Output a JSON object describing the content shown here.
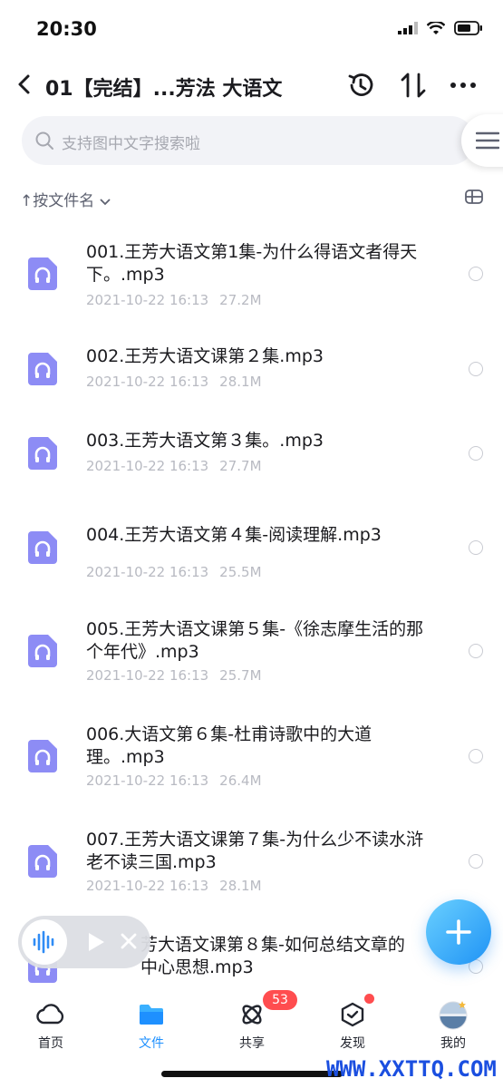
{
  "status": {
    "time": "20:30"
  },
  "nav": {
    "title": "01【完结】...芳法 大语文"
  },
  "search": {
    "placeholder": "支持图中文字搜索啦"
  },
  "sort": {
    "label": "↑按文件名"
  },
  "files": [
    {
      "name": "001.王芳大语文第1集-为什么得语文者得天下。.mp3",
      "date": "2021-10-22 16:13",
      "size": "27.2M"
    },
    {
      "name": "002.王芳大语文课第２集.mp3",
      "date": "2021-10-22 16:13",
      "size": "28.1M"
    },
    {
      "name": "003.王芳大语文第３集。.mp3",
      "date": "2021-10-22 16:13",
      "size": "27.7M"
    },
    {
      "name": "004.王芳大语文第４集-阅读理解.mp3",
      "date": "2021-10-22 16:13",
      "size": "25.5M"
    },
    {
      "name": "005.王芳大语文课第５集-《徐志摩生活的那个年代》.mp3",
      "date": "2021-10-22 16:13",
      "size": "25.7M"
    },
    {
      "name": "006.大语文第６集-杜甫诗歌中的大道理。.mp3",
      "date": "2021-10-22 16:13",
      "size": "26.4M"
    },
    {
      "name": "007.王芳大语文课第７集-为什么少不读水浒 老不读三国.mp3",
      "date": "2021-10-22 16:13",
      "size": "28.1M"
    },
    {
      "name": "芳大语文课第８集-如何总结文章的中心思想.mp3",
      "date": "",
      "size": ""
    }
  ],
  "tabs": [
    {
      "label": "首页",
      "icon": "cloud-icon"
    },
    {
      "label": "文件",
      "icon": "folder-icon"
    },
    {
      "label": "共享",
      "icon": "share-icon"
    },
    {
      "label": "发现",
      "icon": "discover-icon"
    },
    {
      "label": "我的",
      "icon": "avatar"
    }
  ],
  "badges": {
    "share": "53"
  },
  "watermark": "WWW.XXTTQ.COM",
  "colors": {
    "accent": "#1e90ff",
    "file_icon": "#8d8cf5",
    "badge": "#ff4d4f"
  }
}
